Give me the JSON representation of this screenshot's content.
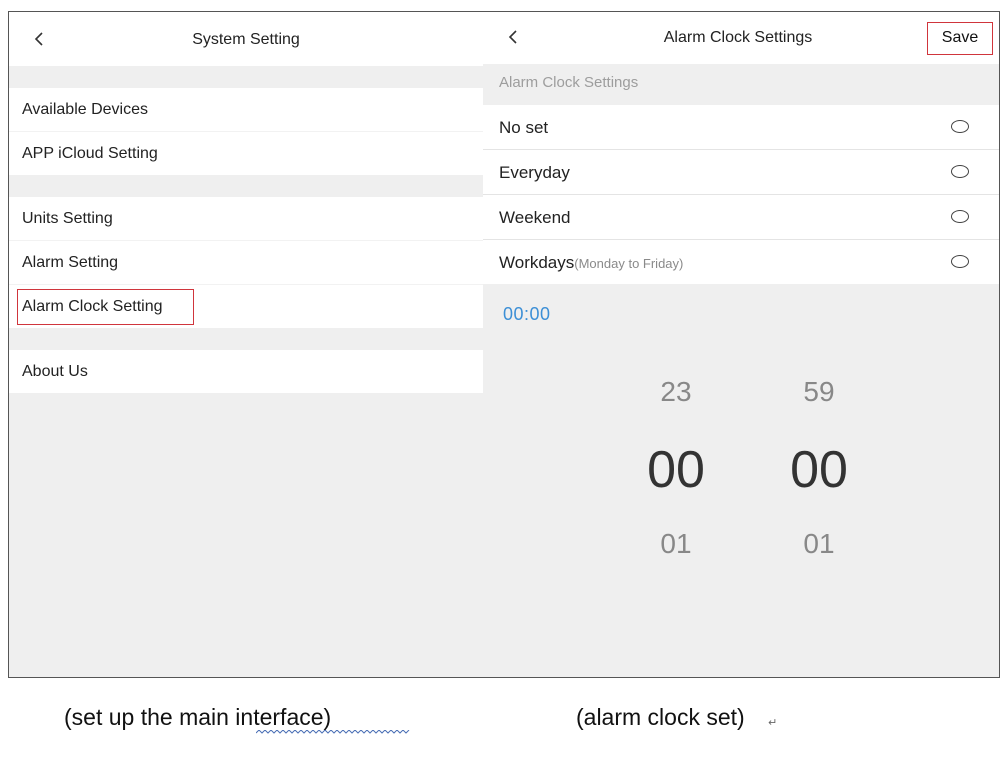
{
  "left_panel": {
    "header": {
      "title": "System Setting"
    },
    "rows": {
      "available_devices": "Available Devices",
      "icloud_setting": "APP iCloud Setting",
      "units_setting": "Units Setting",
      "alarm_setting": "Alarm Setting",
      "alarm_clock_setting": "Alarm Clock Setting",
      "about_us": "About Us"
    }
  },
  "right_panel": {
    "header": {
      "title": "Alarm Clock Settings",
      "save_label": "Save"
    },
    "section_label": "Alarm Clock Settings",
    "options": [
      {
        "label": "No set",
        "sub": ""
      },
      {
        "label": "Everyday",
        "sub": ""
      },
      {
        "label": "Weekend",
        "sub": ""
      },
      {
        "label": "Workdays",
        "sub": "(Monday to Friday)"
      }
    ],
    "time_readout": "00:00",
    "picker": {
      "hours": {
        "prev": "23",
        "current": "00",
        "next": "01"
      },
      "minutes": {
        "prev": "59",
        "current": "00",
        "next": "01"
      }
    }
  },
  "captions": {
    "left": "(set up the main interface)",
    "right": "(alarm clock set)",
    "return_mark": "↵"
  },
  "colors": {
    "highlight_border": "#d0353c",
    "time_readout": "#3c8fd6",
    "background": "#efefef"
  }
}
